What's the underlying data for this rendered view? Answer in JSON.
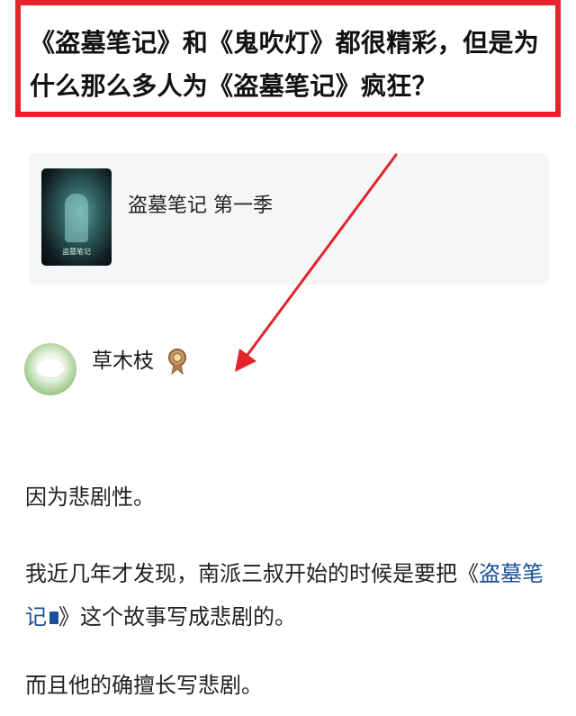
{
  "question": {
    "title": "《盗墓笔记》和《鬼吹灯》都很精彩，但是为什么那么多人为《盗墓笔记》疯狂？"
  },
  "media_card": {
    "title": "盗墓笔记 第一季",
    "poster_text": "盗墓笔记"
  },
  "author": {
    "name": "草木枝"
  },
  "answer": {
    "p1": "因为悲剧性。",
    "p2_prefix": "我近几年才发现，南派三叔开始的时候是要把",
    "p2_quote_open": "《",
    "p2_link": "盗墓笔记",
    "p2_quote_close_and_suffix": "》这个故事写成悲剧的。",
    "p3": "而且他的确擅长写悲剧。"
  },
  "colors": {
    "highlight_border": "#e3242b",
    "arrow": "#e3242b",
    "link": "#175199",
    "card_bg": "#f5f6f7"
  },
  "icons": {
    "badge": "bronze-badge-icon",
    "arrow": "red-arrow",
    "book": "book-icon"
  }
}
